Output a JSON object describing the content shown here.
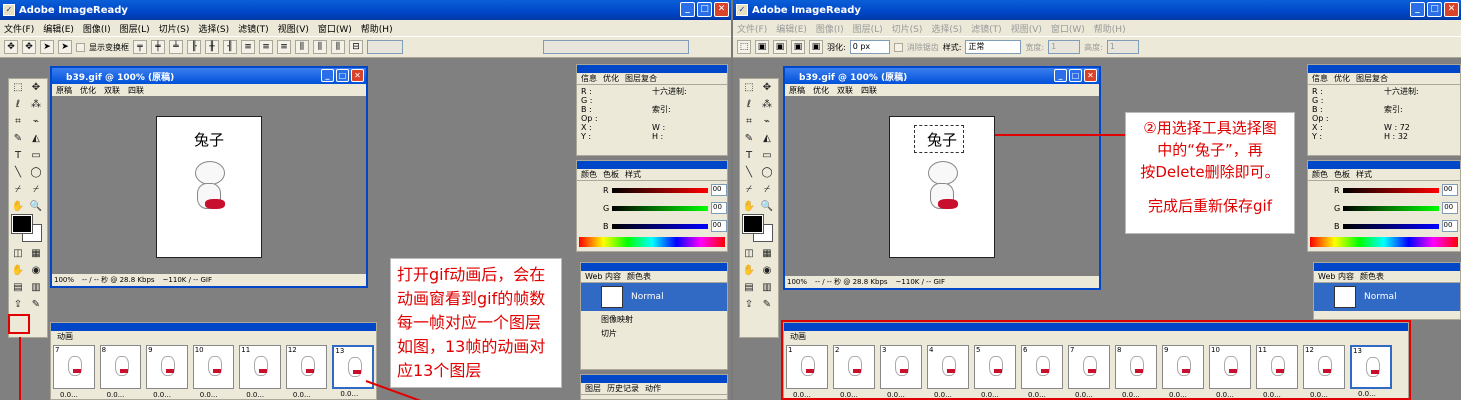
{
  "app_title": "Adobe ImageReady",
  "menu": [
    "文件(F)",
    "编辑(E)",
    "图像(I)",
    "图层(L)",
    "切片(S)",
    "选择(S)",
    "滤镜(T)",
    "视图(V)",
    "窗口(W)",
    "帮助(H)"
  ],
  "left": {
    "options": {
      "show_transform": "显示变换框"
    },
    "doc": {
      "title": "b39.gif @ 100% (原稿)",
      "tabs": [
        "原稿",
        "优化",
        "双联",
        "四联"
      ],
      "canvas_text": "兔子",
      "zoom": "100%",
      "speed": "-- / -- 秒 @ 28.8 Kbps",
      "size": "~110K / -- GIF"
    },
    "frames": [
      "7",
      "8",
      "9",
      "10",
      "11",
      "12",
      "13"
    ],
    "frame_time": "0.0..."
  },
  "right": {
    "options": {
      "feather_label": "羽化:",
      "feather_value": "0 px",
      "antialias": "消除锯齿",
      "style_label": "样式:",
      "style_value": "正常",
      "width_label": "宽度:",
      "width_value": "1",
      "height_label": "高度:",
      "height_value": "1"
    },
    "doc": {
      "title": "b39.gif @ 100% (原稿)",
      "tabs": [
        "原稿",
        "优化",
        "双联",
        "四联"
      ],
      "canvas_text": "兔子",
      "zoom": "100%",
      "speed": "-- / -- 秒 @ 28.8 Kbps",
      "size": "~110K / -- GIF"
    },
    "frames": [
      "1",
      "2",
      "3",
      "4",
      "5",
      "6",
      "7",
      "8",
      "9",
      "10",
      "11",
      "12",
      "13"
    ],
    "frame_time": "0.0...",
    "info_w": "72",
    "info_h": "32"
  },
  "panels": {
    "info_tabs": [
      "信息",
      "优化",
      "图层复合"
    ],
    "info_labels": {
      "r": "R :",
      "g": "G :",
      "b": "B :",
      "op": "Op :",
      "hex": "十六进制:",
      "idx": "索引:",
      "x": "X :",
      "y": "Y :",
      "w": "W :",
      "h": "H :"
    },
    "color_tabs": [
      "颜色",
      "色板",
      "样式"
    ],
    "color_channels": [
      "R",
      "G",
      "B"
    ],
    "color_values": [
      "00",
      "00",
      "00"
    ],
    "web_tabs": [
      "Web 内容",
      "颜色表"
    ],
    "normal_label": "Normal",
    "image_map": "图像映射",
    "slice": "切片",
    "layer_tabs": [
      "图层",
      "历史记录",
      "动作"
    ],
    "anim_title": "动画"
  },
  "annotations": {
    "left_note": [
      "打开gif动画后，会在",
      "动画窗看到gif的帧数",
      "每一帧对应一个图层",
      "如图，13帧的动画对",
      "应13个图层"
    ],
    "right_note": [
      "②用选择工具选择图",
      "中的“兔子”，再",
      "按Delete删除即可。",
      "",
      "完成后重新保存gif"
    ]
  }
}
